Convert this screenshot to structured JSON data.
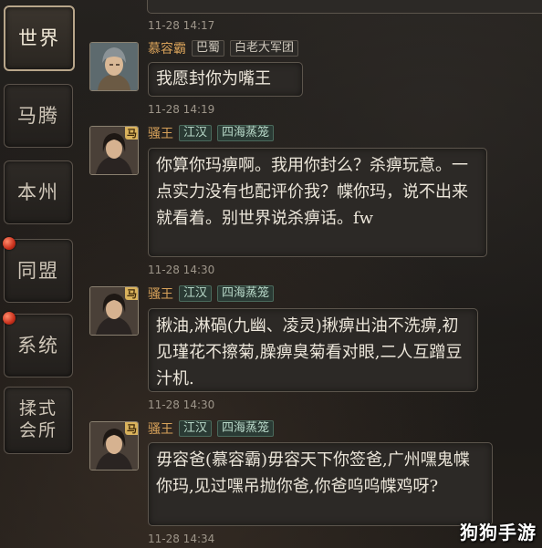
{
  "tabs": [
    {
      "label": "世界",
      "active": true,
      "dot": false
    },
    {
      "label": "马腾",
      "active": false,
      "dot": false
    },
    {
      "label": "本州",
      "active": false,
      "dot": false
    },
    {
      "label": "同盟",
      "active": false,
      "dot": true
    },
    {
      "label": "系统",
      "active": false,
      "dot": true
    },
    {
      "label": "揉式会所",
      "active": false,
      "dot": false
    }
  ],
  "messages": [
    {
      "time": "11-28 14:17"
    },
    {
      "name": "慕容霸",
      "tags": [
        "巴蜀",
        "白老大军团"
      ],
      "vip": "",
      "text": "我愿封你为嘴王"
    },
    {
      "time": "11-28 14:19"
    },
    {
      "name": "骚王",
      "tags": [
        "江汉",
        "四海蒸笼"
      ],
      "vip": "马",
      "text": "你算你玛痹啊。我用你封么？杀痹玩意。一点实力没有也配评价我？幉你玛，说不出来就看着。别世界说杀痹话。fw"
    },
    {
      "time": "11-28 14:30"
    },
    {
      "name": "骚王",
      "tags": [
        "江汉",
        "四海蒸笼"
      ],
      "vip": "马",
      "text": "揪油,淋碢(九幽、凌灵)揪痹出油不洗痹,初见瑾花不擦菊,臊痹臭菊看对眼,二人互蹭豆汁机."
    },
    {
      "time": "11-28 14:30"
    },
    {
      "name": "骚王",
      "tags": [
        "江汉",
        "四海蒸笼"
      ],
      "vip": "马",
      "text": "毋容爸(慕容霸)毋容天下你签爸,广州嘿鬼幉你玛,见过嘿吊抛你爸,你爸呜呜幉鸡呀?"
    },
    {
      "time": "11-28 14:34"
    }
  ],
  "watermark": "狗狗手游"
}
